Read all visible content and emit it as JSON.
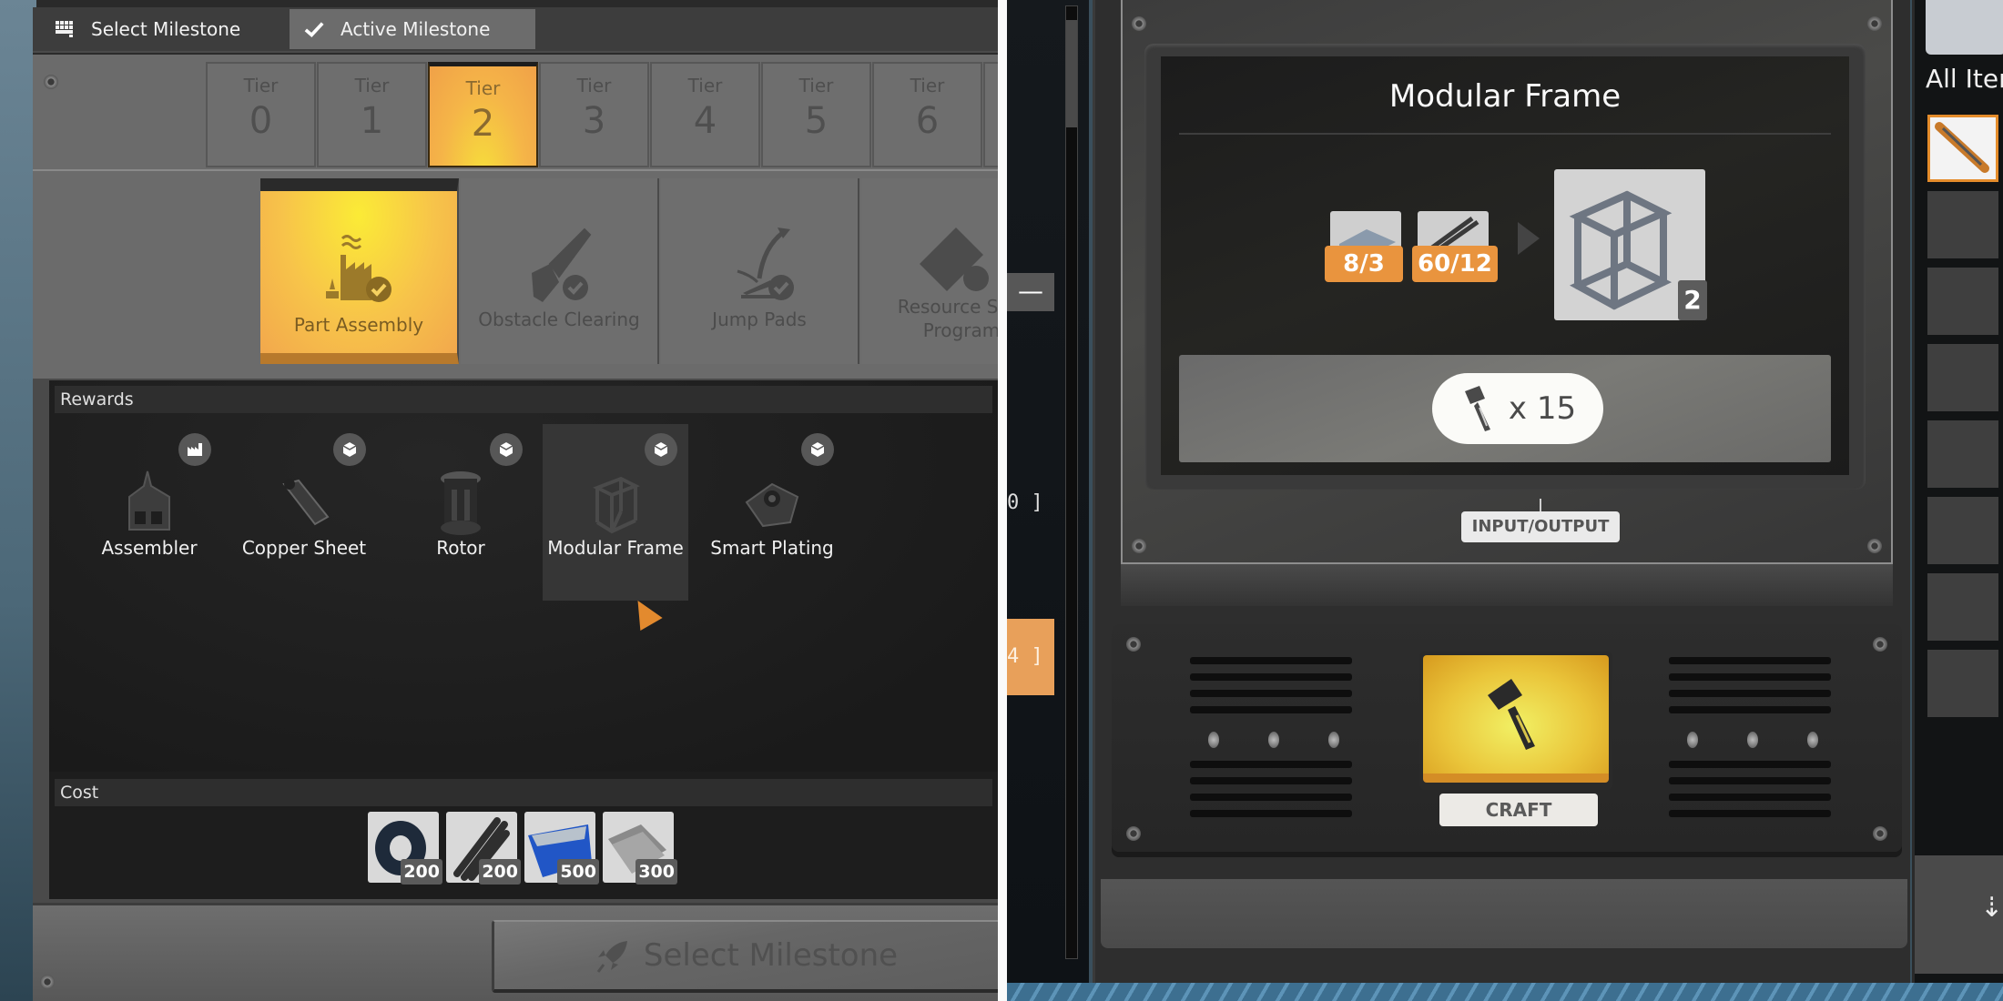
{
  "milestone_panel": {
    "tabs": [
      {
        "label": "Select Milestone",
        "icon": "grid-icon",
        "active": false
      },
      {
        "label": "Active Milestone",
        "icon": "checkmark-icon",
        "active": true
      }
    ],
    "tiers": [
      {
        "label": "Tier",
        "number": "0",
        "active": false
      },
      {
        "label": "Tier",
        "number": "1",
        "active": false
      },
      {
        "label": "Tier",
        "number": "2",
        "active": true
      },
      {
        "label": "Tier",
        "number": "3",
        "active": false
      },
      {
        "label": "Tier",
        "number": "4",
        "active": false
      },
      {
        "label": "Tier",
        "number": "5",
        "active": false
      },
      {
        "label": "Tier",
        "number": "6",
        "active": false
      }
    ],
    "milestones": [
      {
        "label": "Part Assembly",
        "icon": "factory-check-icon",
        "active": true
      },
      {
        "label": "Obstacle Clearing",
        "icon": "chainsaw-check-icon",
        "active": false
      },
      {
        "label": "Jump Pads",
        "icon": "jump-pad-check-icon",
        "active": false
      },
      {
        "label": "Resource Sink Program",
        "icon": "ticket-check-icon",
        "active": false
      }
    ],
    "rewards_header": "Rewards",
    "rewards": [
      {
        "label": "Assembler",
        "badge": "building-badge-icon",
        "selected": false
      },
      {
        "label": "Copper Sheet",
        "badge": "recipe-badge-icon",
        "selected": false
      },
      {
        "label": "Rotor",
        "badge": "recipe-badge-icon",
        "selected": false
      },
      {
        "label": "Modular Frame",
        "badge": "recipe-badge-icon",
        "selected": true
      },
      {
        "label": "Smart Plating",
        "badge": "recipe-badge-icon",
        "selected": false
      }
    ],
    "cost_header": "Cost",
    "cost": [
      {
        "item": "Cable",
        "quantity": "200"
      },
      {
        "item": "Iron Rod",
        "quantity": "200"
      },
      {
        "item": "Screw",
        "quantity": "500"
      },
      {
        "item": "Iron Plate",
        "quantity": "300"
      }
    ],
    "select_button": "Select Milestone"
  },
  "middle": {
    "minus_label": "—",
    "text_a": "0 ]",
    "text_b": "4 ]"
  },
  "craft_bench": {
    "recipe_title": "Modular Frame",
    "ingredients": [
      {
        "item": "Reinforced Iron Plate",
        "amount": "8/3"
      },
      {
        "item": "Iron Rod",
        "amount": "60/12"
      }
    ],
    "output": {
      "item": "Modular Frame",
      "count": "2"
    },
    "craft_clicks": "x 15",
    "io_label": "INPUT/OUTPUT",
    "craft_label": "CRAFT"
  },
  "inventory": {
    "title": "All Items"
  },
  "colors": {
    "accent_orange": "#e9943e",
    "active_yellow": "#f5c542",
    "panel_gray": "#6b6b6b"
  }
}
